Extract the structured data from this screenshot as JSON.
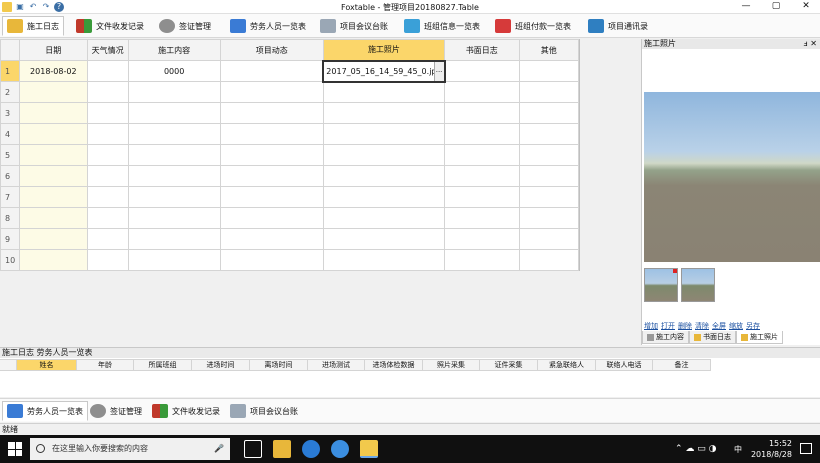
{
  "window": {
    "title": "Foxtable - 管理项目20180827.Table",
    "buttons": [
      "—",
      "▢",
      "✕"
    ]
  },
  "modules_top": [
    {
      "label": "施工日志",
      "icon": "folder-icon",
      "color": "#e8b73a",
      "active": true
    },
    {
      "label": "文件收发记录",
      "icon": "exchange-arrows-icon",
      "color": "#c0392b"
    },
    {
      "label": "签证管理",
      "icon": "stamp-person-icon",
      "color": "#8e8e8e"
    },
    {
      "label": "劳务人员一览表",
      "icon": "id-card-icon",
      "color": "#3a7bd5"
    },
    {
      "label": "项目会议台账",
      "icon": "meeting-icon",
      "color": "#9aa7b5"
    },
    {
      "label": "班组信息一览表",
      "icon": "team-icon",
      "color": "#3aa0d8"
    },
    {
      "label": "班组付款一览表",
      "icon": "calendar-icon",
      "color": "#d63a3a"
    },
    {
      "label": "项目通讯录",
      "icon": "phone-icon",
      "color": "#2f7fc1"
    }
  ],
  "grid": {
    "columns": [
      "日期",
      "天气情况",
      "施工内容",
      "项目动态",
      "施工照片",
      "书面日志",
      "其他"
    ],
    "selected_column": "施工照片",
    "rows": [
      {
        "n": "1",
        "date": "2018-08-02",
        "weather": "",
        "content": "0000",
        "dynamic": "",
        "photo": "2017_05_16_14_59_45_0.jpg",
        "written": "",
        "other": ""
      },
      {
        "n": "2"
      },
      {
        "n": "3"
      },
      {
        "n": "4"
      },
      {
        "n": "5"
      },
      {
        "n": "6"
      },
      {
        "n": "7"
      },
      {
        "n": "8"
      },
      {
        "n": "9"
      },
      {
        "n": "10"
      }
    ],
    "editor_button": "..."
  },
  "right_panel": {
    "title": "施工照片",
    "pin": "ⅎ ✕",
    "actions": [
      "增加",
      "打开",
      "删除",
      "清除",
      "全屏",
      "缩放",
      "另存"
    ],
    "tabs": [
      {
        "label": "施工内容",
        "active": false
      },
      {
        "label": "书面日志",
        "active": false
      },
      {
        "label": "施工照片",
        "active": true
      }
    ]
  },
  "bottom_panel": {
    "breadcrumb": "施工日志  劳务人员一览表",
    "columns": [
      "姓名",
      "年龄",
      "所属班组",
      "进场时间",
      "离场时间",
      "进场测试",
      "进场体检数据",
      "照片采集",
      "证件采集",
      "紧急联络人",
      "联络人电话",
      "备注"
    ],
    "selected_column": "姓名"
  },
  "modules_bottom": [
    {
      "label": "劳务人员一览表",
      "icon": "id-card-icon",
      "color": "#3a7bd5",
      "active": true
    },
    {
      "label": "签证管理",
      "icon": "stamp-person-icon",
      "color": "#8e8e8e"
    },
    {
      "label": "文件收发记录",
      "icon": "exchange-arrows-icon",
      "color": "#c0392b"
    },
    {
      "label": "项目会议台账",
      "icon": "meeting-icon",
      "color": "#9aa7b5"
    }
  ],
  "status": "就绪",
  "taskbar": {
    "search_placeholder": "在这里输入你要搜索的内容",
    "time": "15:52",
    "date": "2018/8/28",
    "ime": "中"
  }
}
